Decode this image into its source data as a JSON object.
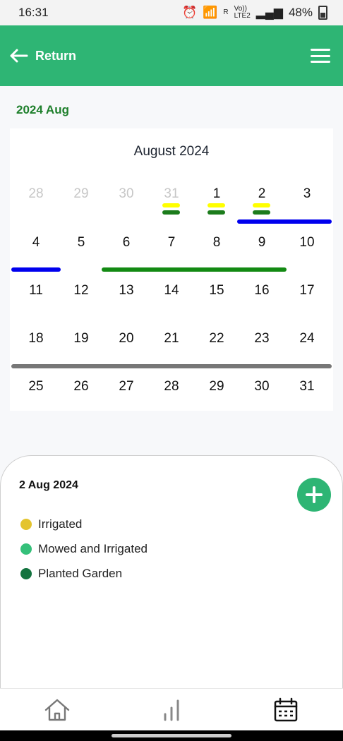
{
  "status": {
    "time": "16:31",
    "battery": "48%",
    "signal_text_1": "Vo))",
    "signal_text_2": "LTE2",
    "r_text": "R"
  },
  "header": {
    "return_label": "Return",
    "menu_icon": "hamburger-icon"
  },
  "calendar": {
    "month_label": "2024 Aug",
    "title": "August 2024",
    "weeks": [
      [
        {
          "d": "28",
          "muted": true
        },
        {
          "d": "29",
          "muted": true
        },
        {
          "d": "30",
          "muted": true
        },
        {
          "d": "31",
          "muted": true
        },
        {
          "d": "1"
        },
        {
          "d": "2"
        },
        {
          "d": "3"
        }
      ],
      [
        {
          "d": "4"
        },
        {
          "d": "5"
        },
        {
          "d": "6"
        },
        {
          "d": "7"
        },
        {
          "d": "8"
        },
        {
          "d": "9"
        },
        {
          "d": "10"
        }
      ],
      [
        {
          "d": "11"
        },
        {
          "d": "12"
        },
        {
          "d": "13"
        },
        {
          "d": "14"
        },
        {
          "d": "15"
        },
        {
          "d": "16"
        },
        {
          "d": "17"
        }
      ],
      [
        {
          "d": "18"
        },
        {
          "d": "19"
        },
        {
          "d": "20"
        },
        {
          "d": "21"
        },
        {
          "d": "22"
        },
        {
          "d": "23"
        },
        {
          "d": "24"
        }
      ],
      [
        {
          "d": "25"
        },
        {
          "d": "26"
        },
        {
          "d": "27"
        },
        {
          "d": "28"
        },
        {
          "d": "29"
        },
        {
          "d": "30"
        },
        {
          "d": "31"
        }
      ]
    ]
  },
  "event_colors": {
    "yellow": "#ffff00",
    "darkgreen": "#1c7c1c",
    "blue": "#0000ee",
    "green": "#138a13",
    "gray": "#777777"
  },
  "sheet": {
    "selected_date": "2 Aug 2024",
    "legend": [
      {
        "label": "Irrigated",
        "color": "#e4c42e"
      },
      {
        "label": "Mowed and Irrigated",
        "color": "#35c07a"
      },
      {
        "label": "Planted Garden",
        "color": "#13733f"
      }
    ]
  },
  "nav": [
    {
      "name": "home-icon"
    },
    {
      "name": "chart-icon"
    },
    {
      "name": "calendar-icon"
    }
  ]
}
